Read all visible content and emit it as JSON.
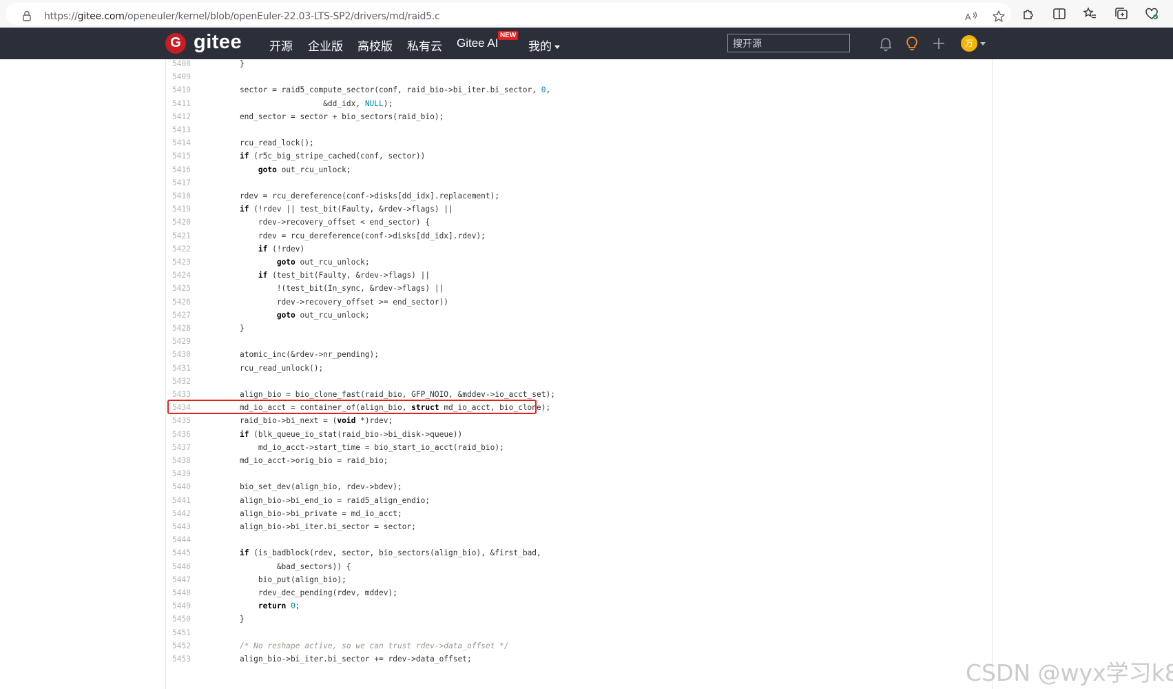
{
  "browser": {
    "url_prefix": "https://",
    "url_domain": "gitee.com",
    "url_path": "/openeuler/kernel/blob/openEuler-22.03-LTS-SP2/drivers/md/raid5.c"
  },
  "header": {
    "logo_letter": "G",
    "logo_text": "gitee",
    "nav": [
      "开源",
      "企业版",
      "高校版",
      "私有云",
      "Gitee AI",
      "我的"
    ],
    "new_badge": "NEW",
    "search_placeholder": "搜开源",
    "avatar_letter": "万",
    "avatar_color": "#f4b400"
  },
  "code": {
    "highlighted_line": 5433,
    "lines": [
      {
        "n": "5408",
        "t": "\t}"
      },
      {
        "n": "5409",
        "t": ""
      },
      {
        "n": "5410",
        "t": "\tsector = raid5_compute_sector(conf, raid_bio->bi_iter.bi_sector, 0,"
      },
      {
        "n": "5411",
        "t": "\t\t\t\t      &dd_idx, NULL);"
      },
      {
        "n": "5412",
        "t": "\tend_sector = sector + bio_sectors(raid_bio);"
      },
      {
        "n": "5413",
        "t": ""
      },
      {
        "n": "5414",
        "t": "\trcu_read_lock();"
      },
      {
        "n": "5415",
        "t": "\tif (r5c_big_stripe_cached(conf, sector))"
      },
      {
        "n": "5416",
        "t": "\t\tgoto out_rcu_unlock;"
      },
      {
        "n": "5417",
        "t": ""
      },
      {
        "n": "5418",
        "t": "\trdev = rcu_dereference(conf->disks[dd_idx].replacement);"
      },
      {
        "n": "5419",
        "t": "\tif (!rdev || test_bit(Faulty, &rdev->flags) ||"
      },
      {
        "n": "5420",
        "t": "\t    rdev->recovery_offset < end_sector) {"
      },
      {
        "n": "5421",
        "t": "\t\trdev = rcu_dereference(conf->disks[dd_idx].rdev);"
      },
      {
        "n": "5422",
        "t": "\t\tif (!rdev)"
      },
      {
        "n": "5423",
        "t": "\t\t\tgoto out_rcu_unlock;"
      },
      {
        "n": "5424",
        "t": "\t\tif (test_bit(Faulty, &rdev->flags) ||"
      },
      {
        "n": "5425",
        "t": "\t\t    !(test_bit(In_sync, &rdev->flags) ||"
      },
      {
        "n": "5426",
        "t": "\t\t    rdev->recovery_offset >= end_sector))"
      },
      {
        "n": "5427",
        "t": "\t\t\tgoto out_rcu_unlock;"
      },
      {
        "n": "5428",
        "t": "\t}"
      },
      {
        "n": "5429",
        "t": ""
      },
      {
        "n": "5430",
        "t": "\tatomic_inc(&rdev->nr_pending);"
      },
      {
        "n": "5431",
        "t": "\trcu_read_unlock();"
      },
      {
        "n": "5432",
        "t": ""
      },
      {
        "n": "5433",
        "t": "\talign_bio = bio_clone_fast(raid_bio, GFP_NOIO, &mddev->io_acct_set);"
      },
      {
        "n": "5434",
        "t": "\tmd_io_acct = container_of(align_bio, struct md_io_acct, bio_clone);"
      },
      {
        "n": "5435",
        "t": "\traid_bio->bi_next = (void *)rdev;"
      },
      {
        "n": "5436",
        "t": "\tif (blk_queue_io_stat(raid_bio->bi_disk->queue))"
      },
      {
        "n": "5437",
        "t": "\t\tmd_io_acct->start_time = bio_start_io_acct(raid_bio);"
      },
      {
        "n": "5438",
        "t": "\tmd_io_acct->orig_bio = raid_bio;"
      },
      {
        "n": "5439",
        "t": ""
      },
      {
        "n": "5440",
        "t": "\tbio_set_dev(align_bio, rdev->bdev);"
      },
      {
        "n": "5441",
        "t": "\talign_bio->bi_end_io = raid5_align_endio;"
      },
      {
        "n": "5442",
        "t": "\talign_bio->bi_private = md_io_acct;"
      },
      {
        "n": "5443",
        "t": "\talign_bio->bi_iter.bi_sector = sector;"
      },
      {
        "n": "5444",
        "t": ""
      },
      {
        "n": "5445",
        "t": "\tif (is_badblock(rdev, sector, bio_sectors(align_bio), &first_bad,"
      },
      {
        "n": "5446",
        "t": "\t\t\t&bad_sectors)) {"
      },
      {
        "n": "5447",
        "t": "\t\tbio_put(align_bio);"
      },
      {
        "n": "5448",
        "t": "\t\trdev_dec_pending(rdev, mddev);"
      },
      {
        "n": "5449",
        "t": "\t\treturn 0;"
      },
      {
        "n": "5450",
        "t": "\t}"
      },
      {
        "n": "5451",
        "t": ""
      },
      {
        "n": "5452",
        "t": "\t/* No reshape active, so we can trust rdev->data_offset */"
      },
      {
        "n": "5453",
        "t": "\talign_bio->bi_iter.bi_sector += rdev->data_offset;"
      }
    ]
  },
  "watermark": "CSDN @wyx学习k8s"
}
